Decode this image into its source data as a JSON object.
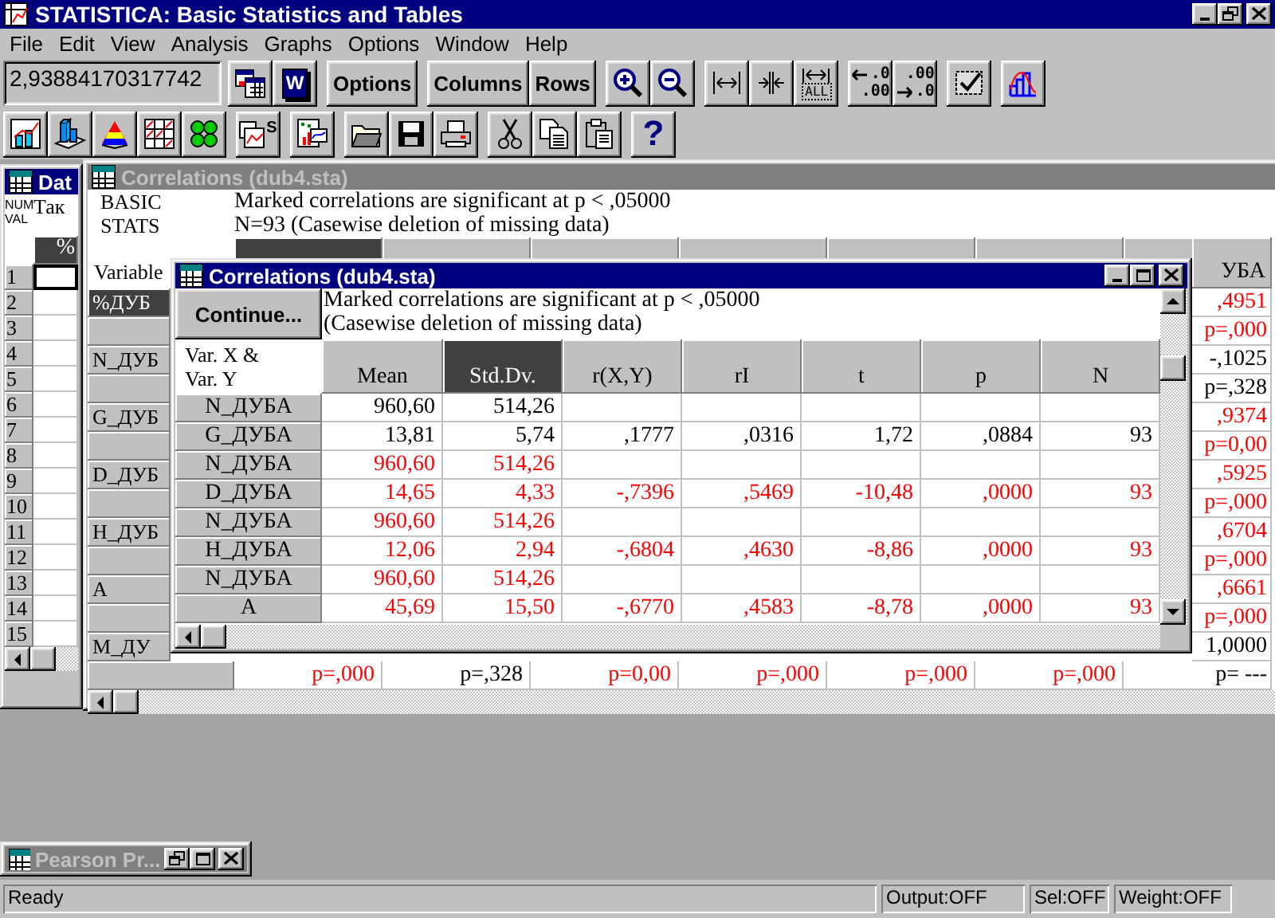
{
  "window": {
    "title": "STATISTICA: Basic Statistics and Tables"
  },
  "menu": [
    "File",
    "Edit",
    "View",
    "Analysis",
    "Graphs",
    "Options",
    "Window",
    "Help"
  ],
  "toolbar": {
    "value_field": "2,93884170317742",
    "report_label": "W",
    "text_buttons": [
      "Options",
      "Columns",
      "Rows"
    ],
    "fit_all_label": "ALL",
    "decimal_buttons": [
      {
        "top": ".0",
        "bottom": ".00"
      },
      {
        "top": ".00",
        "bottom": ".0"
      }
    ],
    "stats_label": "S",
    "help_label": "?"
  },
  "data_window": {
    "title": "Dat",
    "corner_labels": [
      "NUM",
      "VAL"
    ],
    "variable_label": "Так",
    "column_header": "%",
    "rows": [
      {
        "number": "1",
        "selected": true
      },
      {
        "number": "2",
        "selected": false
      },
      {
        "number": "3",
        "selected": false
      },
      {
        "number": "4",
        "selected": false
      },
      {
        "number": "5",
        "selected": false
      },
      {
        "number": "6",
        "selected": false
      },
      {
        "number": "7",
        "selected": false
      },
      {
        "number": "8",
        "selected": false
      },
      {
        "number": "9",
        "selected": false
      },
      {
        "number": "10",
        "selected": false
      },
      {
        "number": "11",
        "selected": false
      },
      {
        "number": "12",
        "selected": false
      },
      {
        "number": "13",
        "selected": false
      },
      {
        "number": "14",
        "selected": false
      },
      {
        "number": "15",
        "selected": false
      }
    ]
  },
  "back_window": {
    "title": "Correlations (dub4.sta)",
    "side_labels": [
      "BASIC",
      "STATS"
    ],
    "notes": [
      "Marked correlations are significant at p < ,05000",
      "N=93 (Casewise deletion of missing data)"
    ],
    "corner_label": "Variable",
    "columns": [
      {
        "selected": true
      },
      {
        "selected": false
      },
      {
        "selected": false
      },
      {
        "selected": false
      },
      {
        "selected": false
      },
      {
        "selected": false
      },
      {
        "label": "УБА",
        "selected": false
      }
    ],
    "rows": [
      {
        "label": "%ДУБ",
        "selected": true,
        "value": ",4951",
        "significant": true
      },
      {
        "selected": false,
        "value": "p=,000",
        "significant": true
      },
      {
        "label": "N_ДУБ",
        "selected": false,
        "value": "-,1025",
        "significant": false
      },
      {
        "selected": false,
        "value": "p=,328",
        "significant": false
      },
      {
        "label": "G_ДУБ",
        "selected": false,
        "value": ",9374",
        "significant": true
      },
      {
        "selected": false,
        "value": "p=0,00",
        "significant": true
      },
      {
        "label": "D_ДУБ",
        "selected": false,
        "value": ",5925",
        "significant": true
      },
      {
        "selected": false,
        "value": "p=,000",
        "significant": true
      },
      {
        "label": "H_ДУБ",
        "selected": false,
        "value": ",6704",
        "significant": true
      },
      {
        "selected": false,
        "value": "p=,000",
        "significant": true
      },
      {
        "label": "A",
        "selected": false,
        "value": ",6661",
        "significant": true
      },
      {
        "selected": false,
        "value": "p=,000",
        "significant": true
      },
      {
        "label": "M_ДУ",
        "selected": false,
        "value": "1,0000",
        "significant": false
      },
      {
        "selected": false,
        "value": "p= ---",
        "significant": false,
        "cells": [
          {
            "text": "p=,000",
            "significant": true
          },
          {
            "text": "p=,328",
            "significant": false
          },
          {
            "text": "p=0,00",
            "significant": true
          },
          {
            "text": "p=,000",
            "significant": true
          },
          {
            "text": "p=,000",
            "significant": true
          },
          {
            "text": "p=,000",
            "significant": true
          }
        ]
      }
    ]
  },
  "front_window": {
    "title": "Correlations (dub4.sta)",
    "continue_button": "Continue...",
    "notes": [
      "Marked correlations are significant at p < ,05000",
      "(Casewise deletion of missing data)"
    ],
    "row_header_label": [
      "Var. X &",
      "Var. Y"
    ],
    "columns": [
      {
        "label": "Mean",
        "selected": false
      },
      {
        "label": "Std.Dv.",
        "selected": true
      },
      {
        "label": "r(X,Y)",
        "selected": false
      },
      {
        "label": "rI",
        "selected": false
      },
      {
        "label": "t",
        "selected": false
      },
      {
        "label": "p",
        "selected": false
      },
      {
        "label": "N",
        "selected": false
      }
    ],
    "rows": [
      {
        "label": "N_ДУБА",
        "cells": [
          "960,60",
          "514,26"
        ],
        "significant": false
      },
      {
        "label": "G_ДУБА",
        "cells": [
          "13,81",
          "5,74",
          ",1777",
          ",0316",
          "1,72",
          ",0884",
          "93"
        ],
        "significant": false
      },
      {
        "label": "N_ДУБА",
        "cells": [
          "960,60",
          "514,26"
        ],
        "significant": true
      },
      {
        "label": "D_ДУБА",
        "cells": [
          "14,65",
          "4,33",
          "-,7396",
          ",5469",
          "-10,48",
          ",0000",
          "93"
        ],
        "significant": true
      },
      {
        "label": "N_ДУБА",
        "cells": [
          "960,60",
          "514,26"
        ],
        "significant": true
      },
      {
        "label": "H_ДУБА",
        "cells": [
          "12,06",
          "2,94",
          "-,6804",
          ",4630",
          "-8,86",
          ",0000",
          "93"
        ],
        "significant": true
      },
      {
        "label": "N_ДУБА",
        "cells": [
          "960,60",
          "514,26"
        ],
        "significant": true
      },
      {
        "label": "A",
        "cells": [
          "45,69",
          "15,50",
          "-,6770",
          ",4583",
          "-8,78",
          ",0000",
          "93"
        ],
        "significant": true
      }
    ]
  },
  "minimized_window": {
    "title": "Pearson Pr..."
  },
  "status_bar": [
    "Ready",
    "Output:OFF",
    "Sel:OFF",
    "Weight:OFF"
  ]
}
